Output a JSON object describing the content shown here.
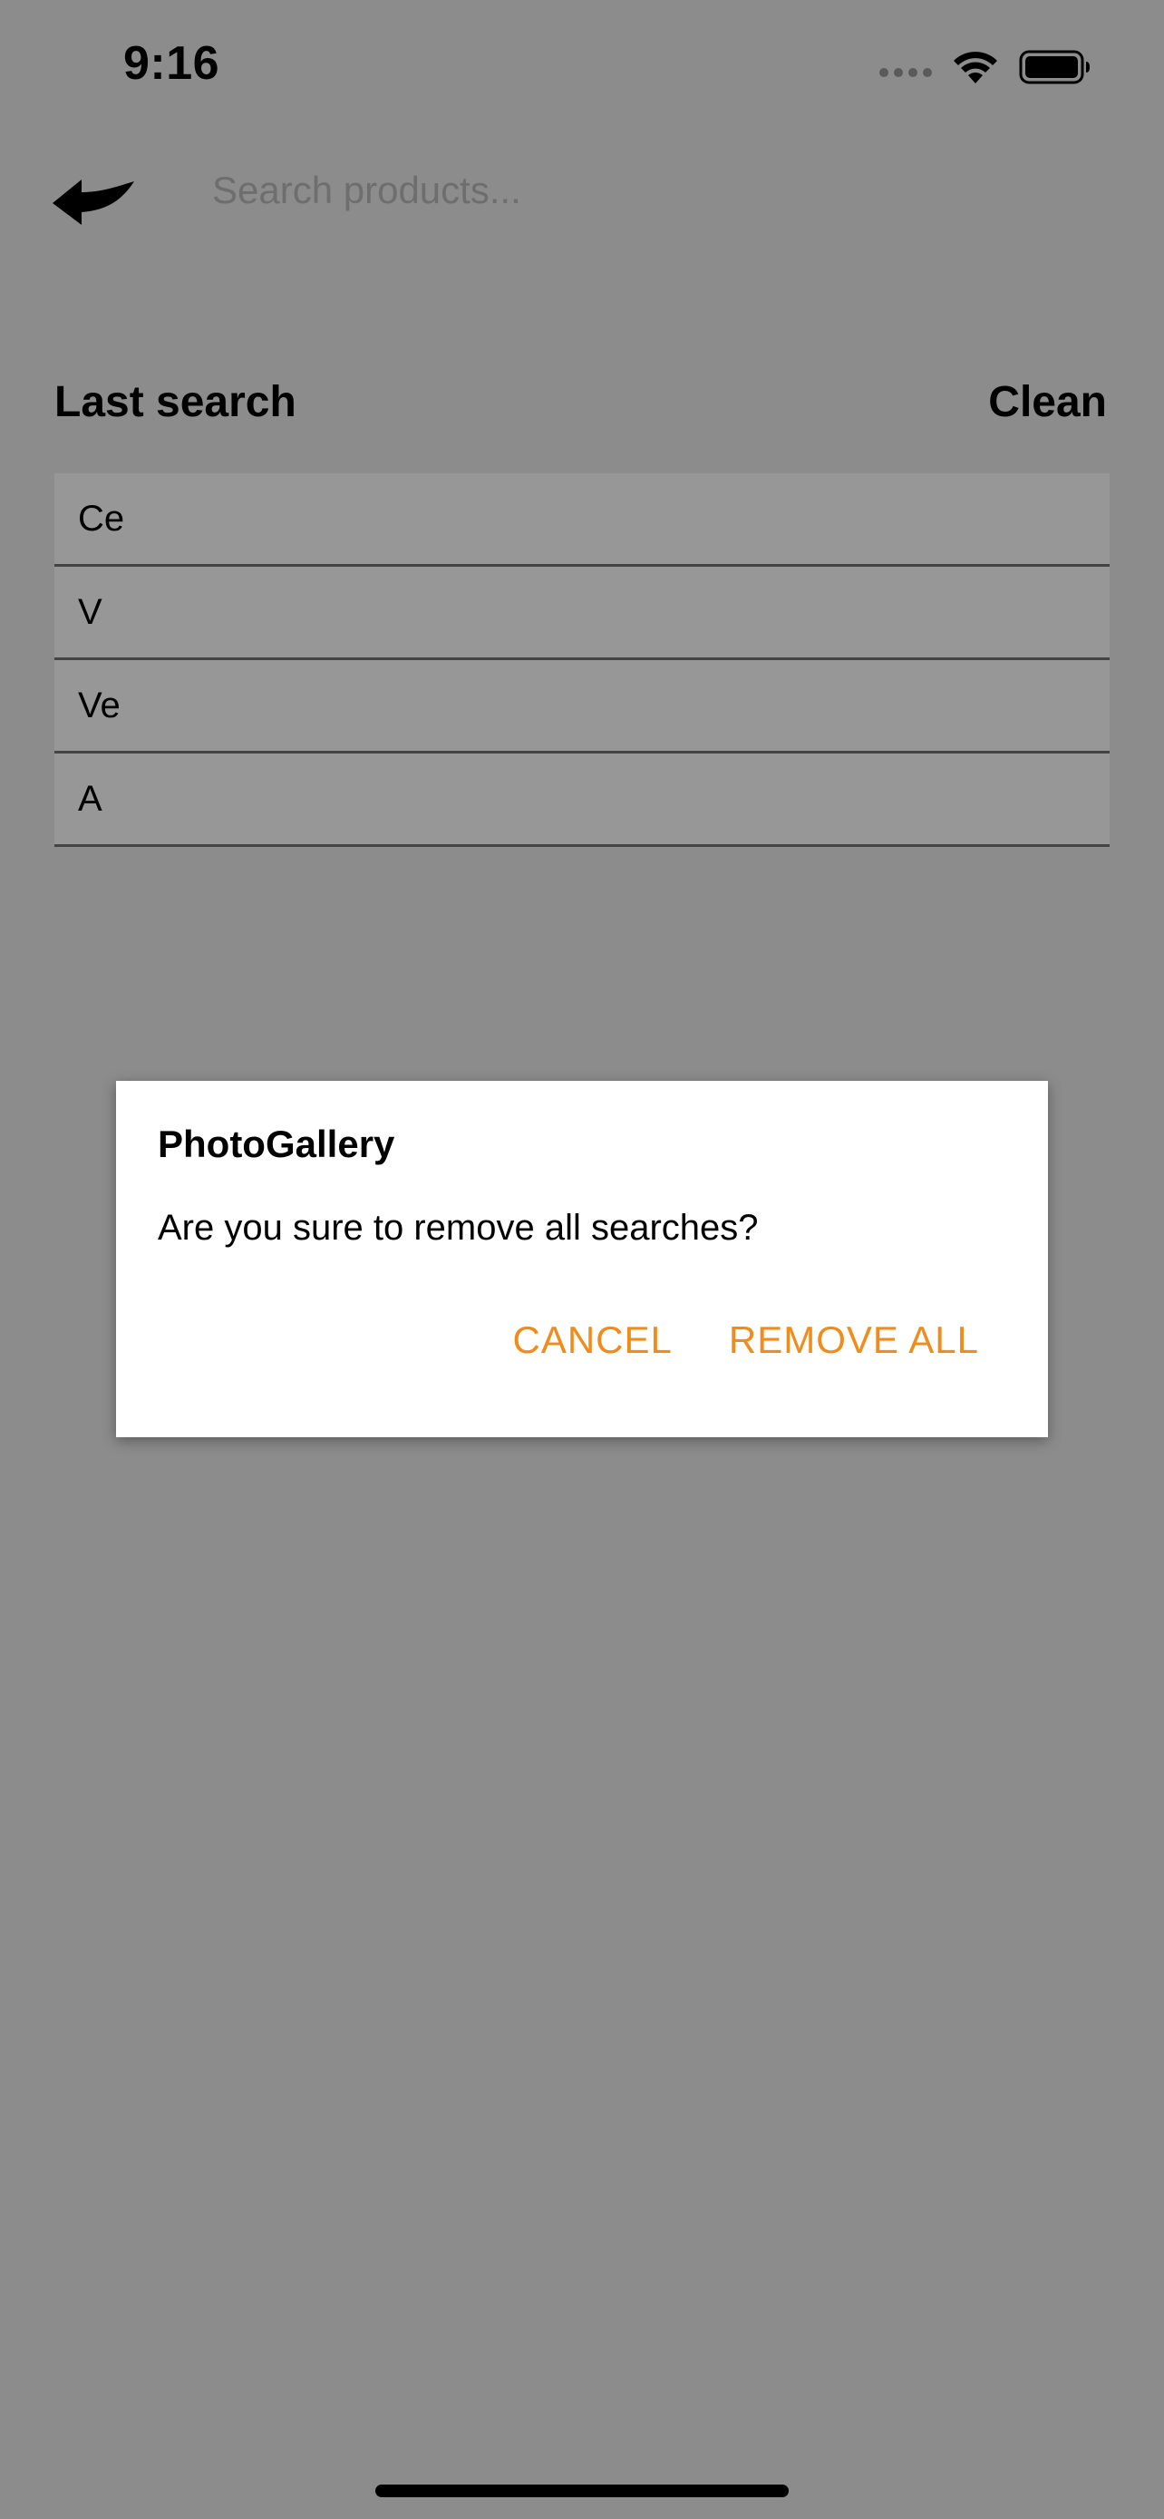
{
  "status_bar": {
    "time": "9:16"
  },
  "header": {
    "back_icon": "back-arrow-icon",
    "search_placeholder": "Search products..."
  },
  "recent": {
    "title": "Last search",
    "clean_label": "Clean",
    "items": [
      "Ce",
      "V",
      "Ve",
      "A"
    ]
  },
  "dialog": {
    "title": "PhotoGallery",
    "message": "Are you sure to remove all searches?",
    "cancel_label": "CANCEL",
    "remove_label": "REMOVE ALL",
    "accent_color": "#f08c1c"
  },
  "colors": {
    "overlay_background": "#8c8c8c",
    "list_item_background": "#979797"
  }
}
